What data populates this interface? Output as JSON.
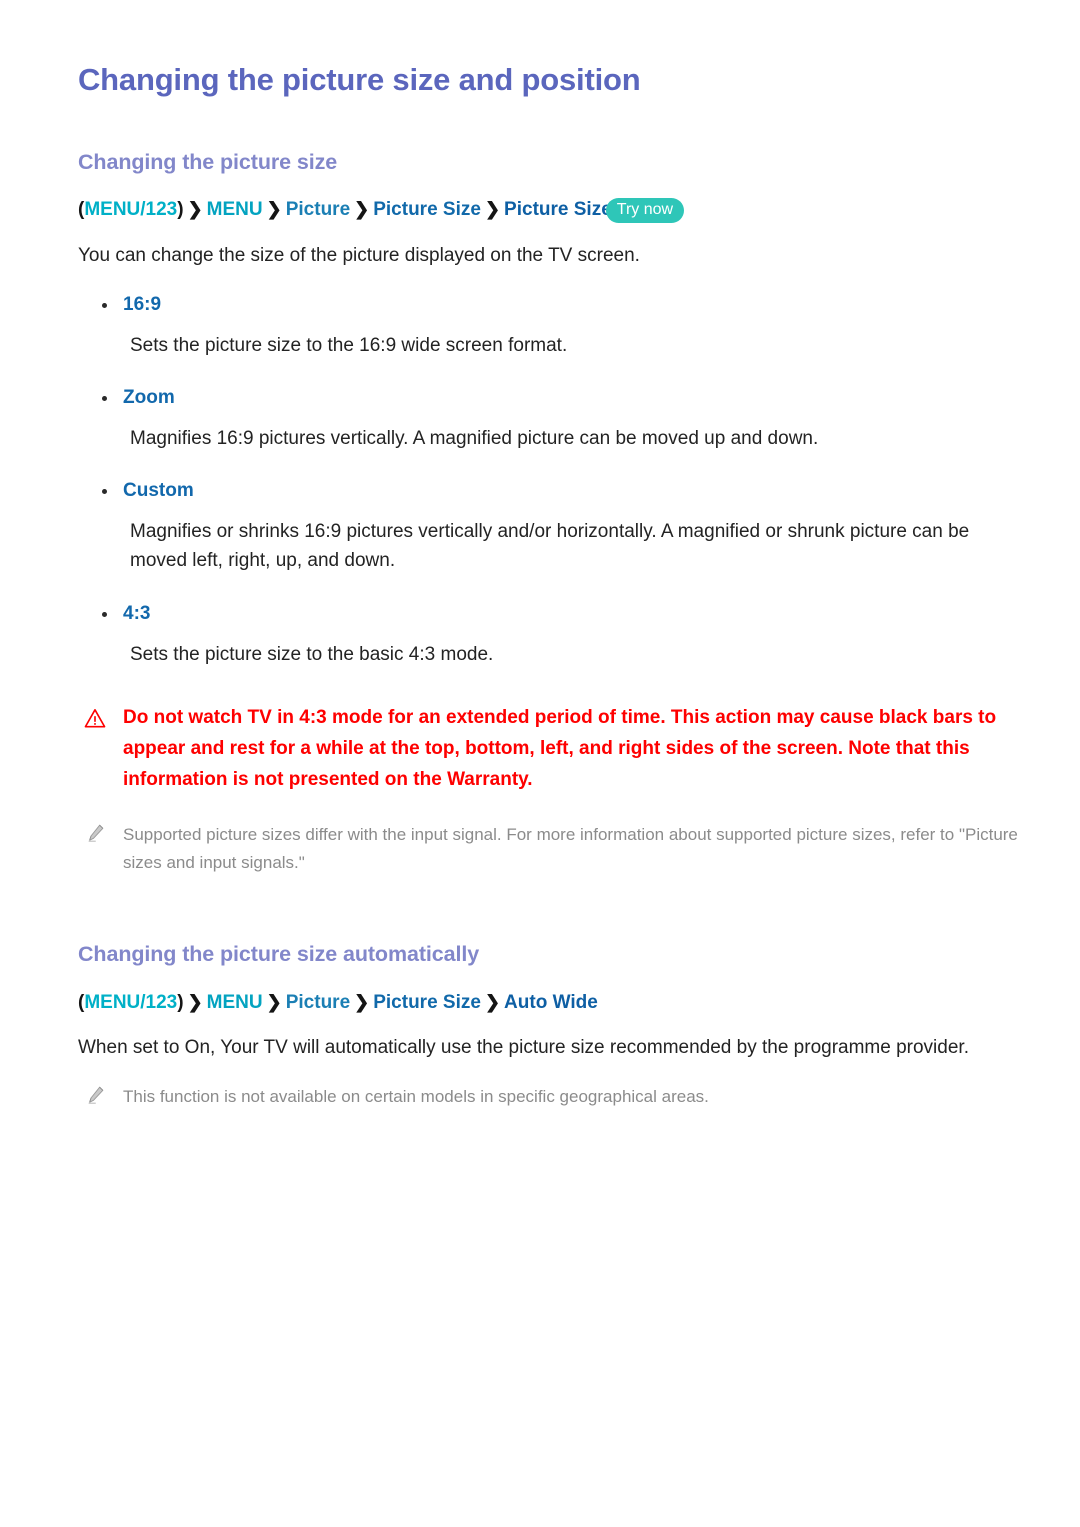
{
  "page": {
    "title": "Changing the picture size and position"
  },
  "sections": [
    {
      "heading": "Changing the picture size",
      "breadcrumb": {
        "open_paren": "(",
        "close_paren": ")",
        "separator": "❯",
        "crumbs": [
          "MENU/123",
          "MENU",
          "Picture",
          "Picture Size",
          "Picture Size"
        ],
        "badge": "Try now"
      },
      "intro": "You can change the size of the picture displayed on the TV screen.",
      "bullets": [
        {
          "term": "16:9",
          "desc": "Sets the picture size to the 16:9 wide screen format."
        },
        {
          "term": "Zoom",
          "desc": "Magnifies 16:9 pictures vertically. A magnified picture can be moved up and down."
        },
        {
          "term": "Custom",
          "desc": "Magnifies or shrinks 16:9 pictures vertically and/or horizontally. A magnified or shrunk picture can be moved left, right, up, and down."
        },
        {
          "term": "4:3",
          "desc": "Sets the picture size to the basic 4:3 mode."
        }
      ],
      "caution": "Do not watch TV in 4:3 mode for an extended period of time. This action may cause black bars to appear and rest for a while at the top, bottom, left, and right sides of the screen. Note that this information is not presented on the Warranty.",
      "note": "Supported picture sizes differ with the input signal. For more information about supported picture sizes, refer to \"Picture sizes and input signals.\""
    },
    {
      "heading": "Changing the picture size automatically",
      "breadcrumb": {
        "open_paren": "(",
        "close_paren": ")",
        "separator": "❯",
        "crumbs": [
          "MENU/123",
          "MENU",
          "Picture",
          "Picture Size",
          "Auto Wide"
        ]
      },
      "intro": "When set to On, Your TV will automatically use the picture size recommended by the programme provider.",
      "note": "This function is not available on certain models in specific geographical areas."
    }
  ],
  "icons": {
    "warning": "warning-triangle-icon",
    "pencil": "pencil-icon"
  },
  "colors": {
    "page_title": "#5b66bd",
    "section_title": "#8287ca",
    "crumb_start": "#00b0c7",
    "crumb_end": "#0e5fa4",
    "badge_bg": "#2ec6b8",
    "caution": "#fe0000",
    "note": "#8b8b8b",
    "body": "#232323",
    "bullet_term": "#1268ac"
  }
}
